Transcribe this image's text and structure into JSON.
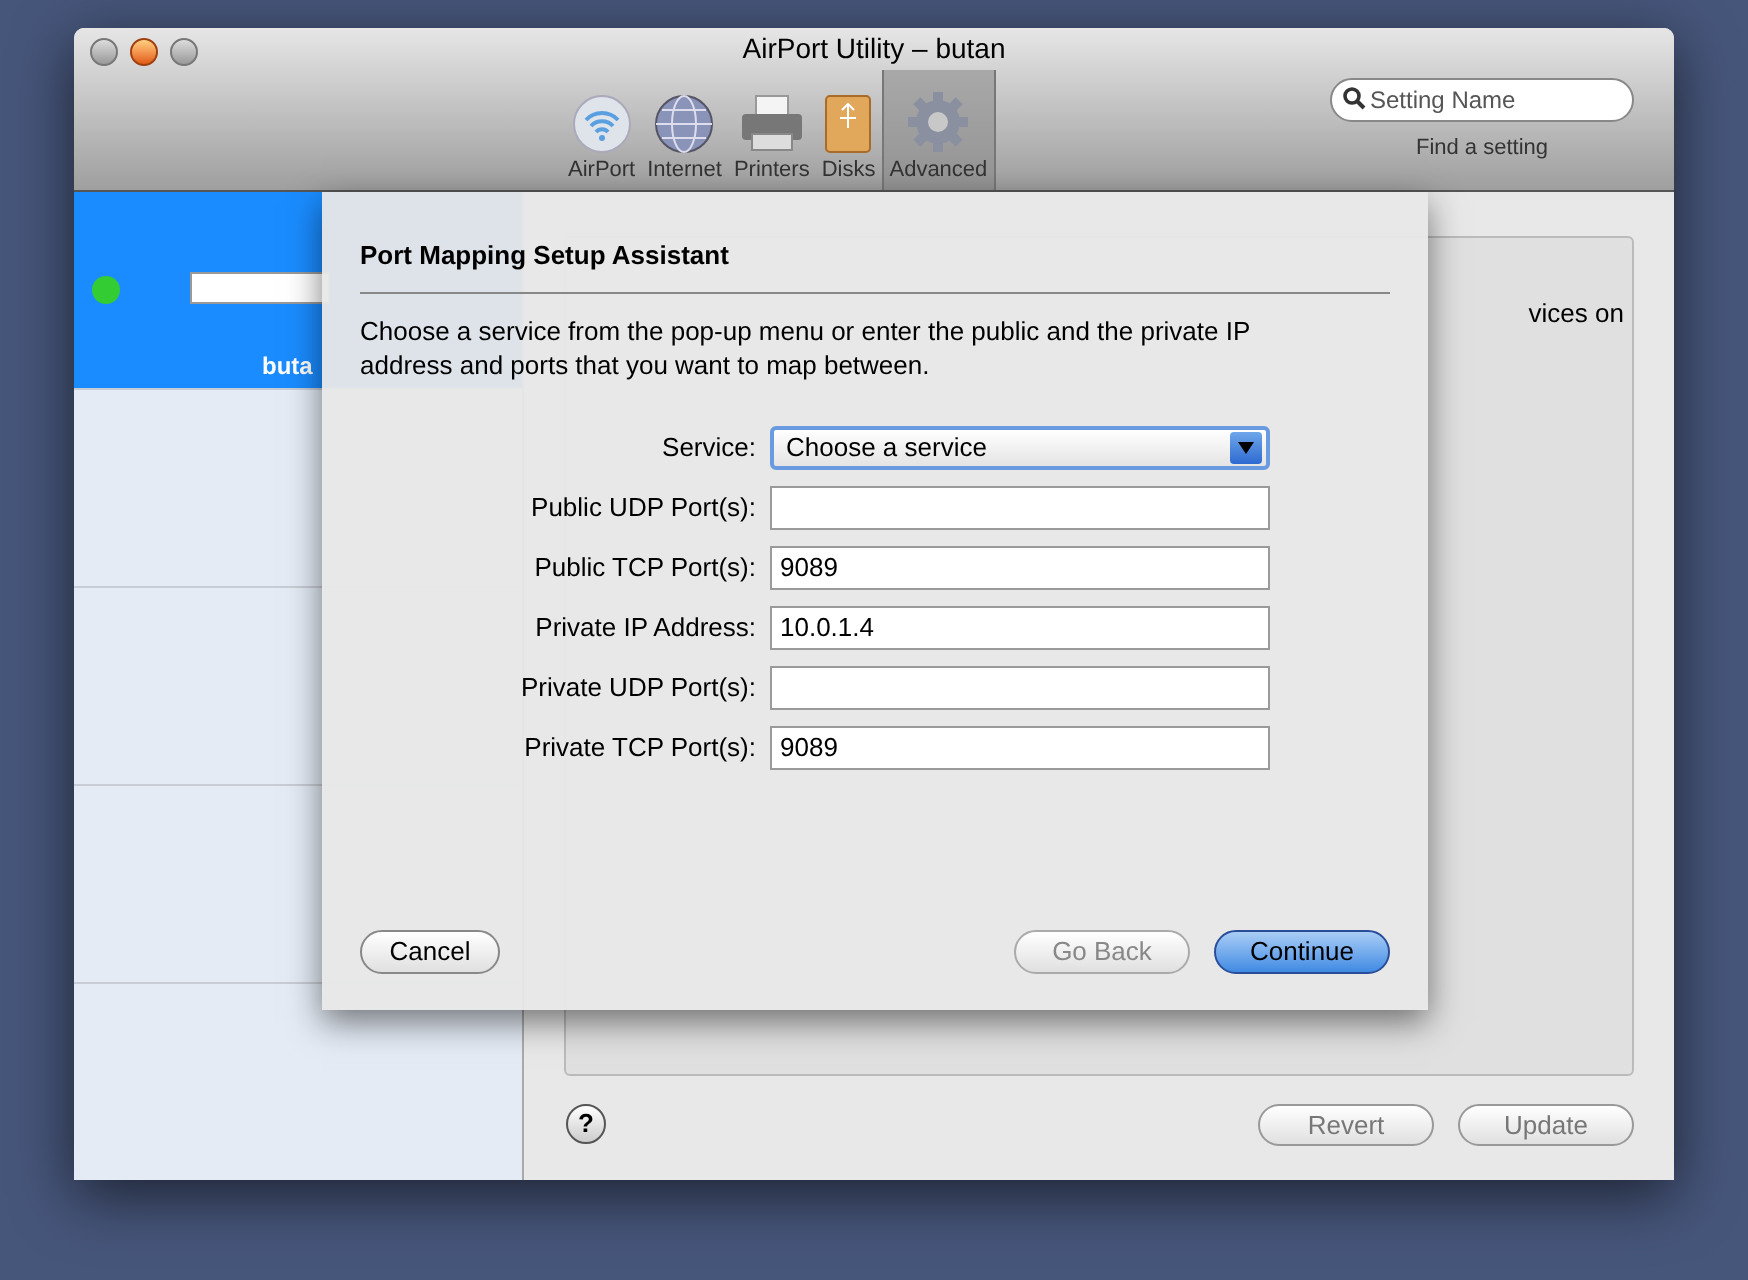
{
  "window": {
    "title": "AirPort Utility – butan"
  },
  "toolbar": {
    "items": [
      {
        "label": "AirPort",
        "kind": "wifi",
        "selected": false
      },
      {
        "label": "Internet",
        "kind": "globe",
        "selected": false
      },
      {
        "label": "Printers",
        "kind": "printer",
        "selected": false
      },
      {
        "label": "Disks",
        "kind": "disk",
        "selected": false
      },
      {
        "label": "Advanced",
        "kind": "gear",
        "selected": true
      }
    ]
  },
  "search": {
    "placeholder": "Setting Name",
    "caption": "Find a setting"
  },
  "sidebar": {
    "items": [
      {
        "name": "buta",
        "color": "#33cc33",
        "selected": true
      }
    ]
  },
  "background_panel": {
    "text_fragment": "vices on"
  },
  "sheet": {
    "title": "Port Mapping Setup Assistant",
    "description": "Choose a service from the pop-up menu or enter the public and the private IP address and ports that you want to map between.",
    "fields": [
      {
        "label": "Service:",
        "kind": "select",
        "value": "Choose a service"
      },
      {
        "label": "Public UDP Port(s):",
        "kind": "text"
      },
      {
        "label": "Public TCP Port(s):",
        "kind": "text",
        "value": "9089"
      },
      {
        "label": "Private IP Address:",
        "kind": "text",
        "value": "10.0.1.4"
      },
      {
        "label": "Private UDP Port(s):",
        "kind": "text"
      },
      {
        "label": "Private TCP Port(s):",
        "kind": "text",
        "value": "9089"
      }
    ],
    "buttons": [
      {
        "label": "Cancel",
        "disabled": false,
        "default": false
      },
      {
        "label": "Go Back",
        "disabled": true,
        "default": false
      },
      {
        "label": "Continue",
        "disabled": false,
        "default": true
      }
    ]
  },
  "footer": {
    "help": "?",
    "buttons": [
      {
        "label": "Revert",
        "disabled": true
      },
      {
        "label": "Update",
        "disabled": true
      }
    ]
  }
}
